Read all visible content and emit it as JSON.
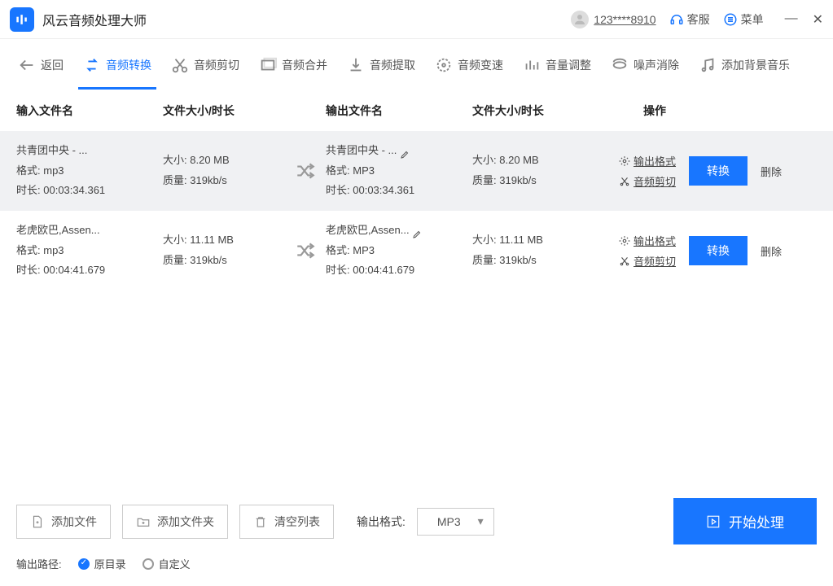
{
  "app": {
    "title": "风云音频处理大师"
  },
  "header": {
    "user_id": "123****8910",
    "support": "客服",
    "menu": "菜单"
  },
  "toolbar": {
    "back": "返回",
    "tabs": [
      {
        "label": "音频转换",
        "icon": "convert",
        "active": true
      },
      {
        "label": "音频剪切",
        "icon": "cut",
        "active": false
      },
      {
        "label": "音频合并",
        "icon": "merge",
        "active": false
      },
      {
        "label": "音频提取",
        "icon": "extract",
        "active": false
      },
      {
        "label": "音频变速",
        "icon": "speed",
        "active": false
      },
      {
        "label": "音量调整",
        "icon": "volume",
        "active": false
      },
      {
        "label": "噪声消除",
        "icon": "noise",
        "active": false
      },
      {
        "label": "添加背景音乐",
        "icon": "bgm",
        "active": false
      }
    ]
  },
  "table": {
    "headers": {
      "input_name": "输入文件名",
      "size_duration1": "文件大小/时长",
      "output_name": "输出文件名",
      "size_duration2": "文件大小/时长",
      "actions": "操作"
    },
    "labels": {
      "format": "格式:",
      "duration": "时长:",
      "size": "大小:",
      "quality": "质量:",
      "output_format": "输出格式",
      "audio_cut": "音频剪切",
      "convert": "转换",
      "delete": "删除"
    },
    "rows": [
      {
        "in_name": "共青团中央 - ...",
        "in_format": "mp3",
        "in_duration": "00:03:34.361",
        "size": "8.20 MB",
        "quality": "319kb/s",
        "out_name": "共青团中央 - ...",
        "out_format": "MP3",
        "out_duration": "00:03:34.361"
      },
      {
        "in_name": "老虎欧巴,Assen...",
        "in_format": "mp3",
        "in_duration": "00:04:41.679",
        "size": "11.11 MB",
        "quality": "319kb/s",
        "out_name": "老虎欧巴,Assen...",
        "out_format": "MP3",
        "out_duration": "00:04:41.679"
      }
    ]
  },
  "bottom": {
    "add_file": "添加文件",
    "add_folder": "添加文件夹",
    "clear_list": "清空列表",
    "output_format_label": "输出格式:",
    "output_format_value": "MP3",
    "start": "开始处理",
    "output_path_label": "输出路径:",
    "radio_original": "原目录",
    "radio_custom": "自定义"
  }
}
